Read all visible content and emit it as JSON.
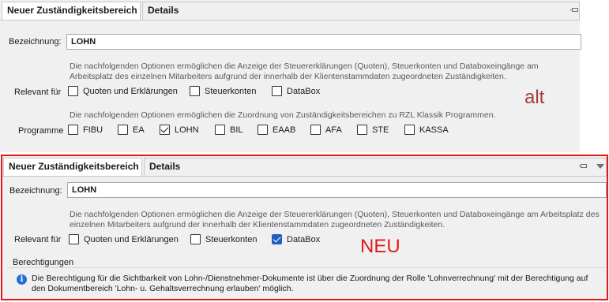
{
  "alt": {
    "tabs": [
      {
        "label": "Neuer Zuständigkeitsbereich"
      },
      {
        "label": "Details"
      }
    ],
    "bezeichnung_label": "Bezeichnung:",
    "bezeichnung_value": "LOHN",
    "desc_relevant": "Die nachfolgenden Optionen ermöglichen die Anzeige der Steuererklärungen (Quoten), Steuerkonten und Databoxeingänge am Arbeitsplatz des einzelnen Mitarbeiters aufgrund der innerhalb der Klientenstammdaten zugeordneten Zuständigkeiten.",
    "relevant_label": "Relevant für",
    "relevant_options": [
      {
        "label": "Quoten und Erklärungen",
        "checked": false
      },
      {
        "label": "Steuerkonten",
        "checked": false
      },
      {
        "label": "DataBox",
        "checked": false
      }
    ],
    "desc_programme": "Die nachfolgenden Optionen ermöglichen die Zuordnung von Zuständigkeitsbereichen zu RZL Klassik Programmen.",
    "programme_label": "Programme",
    "programme_options": [
      {
        "label": "FIBU",
        "checked": false
      },
      {
        "label": "EA",
        "checked": false
      },
      {
        "label": "LOHN",
        "checked": true
      },
      {
        "label": "BIL",
        "checked": false
      },
      {
        "label": "EAAB",
        "checked": false
      },
      {
        "label": "AFA",
        "checked": false
      },
      {
        "label": "STE",
        "checked": false
      },
      {
        "label": "KASSA",
        "checked": false
      }
    ],
    "overlay_text": "alt",
    "overlay_color": "#a23c3c"
  },
  "neu": {
    "tabs": [
      {
        "label": "Neuer Zuständigkeitsbereich"
      },
      {
        "label": "Details"
      }
    ],
    "bezeichnung_label": "Bezeichnung:",
    "bezeichnung_value": "LOHN",
    "desc_relevant": "Die nachfolgenden Optionen ermöglichen die Anzeige der Steuererklärungen (Quoten), Steuerkonten und Databoxeingänge am Arbeitsplatz des einzelnen Mitarbeiters aufgrund der innerhalb der Klientenstammdaten zugeordneten Zuständigkeiten.",
    "relevant_label": "Relevant für",
    "relevant_options": [
      {
        "label": "Quoten und Erklärungen",
        "checked": false
      },
      {
        "label": "Steuerkonten",
        "checked": false
      },
      {
        "label": "DataBox",
        "checked": true
      }
    ],
    "berechtigungen_label": "Berechtigungen",
    "info_text": "Die Berechtigung für die Sichtbarkeit von Lohn-/Dienstnehmer-Dokumente ist über die Zuordnung der Rolle 'Lohnverrechnung' mit der Berechtigung auf den Dokumentbereich 'Lohn- u. Gehaltsverrechnung erlauben' möglich.",
    "overlay_text": "NEU",
    "overlay_color": "#e01a1a",
    "frame_color": "#e01a1a"
  },
  "icons": {
    "pin": "pin-icon",
    "dropdown": "chevron-down-icon",
    "info": "info-icon"
  }
}
